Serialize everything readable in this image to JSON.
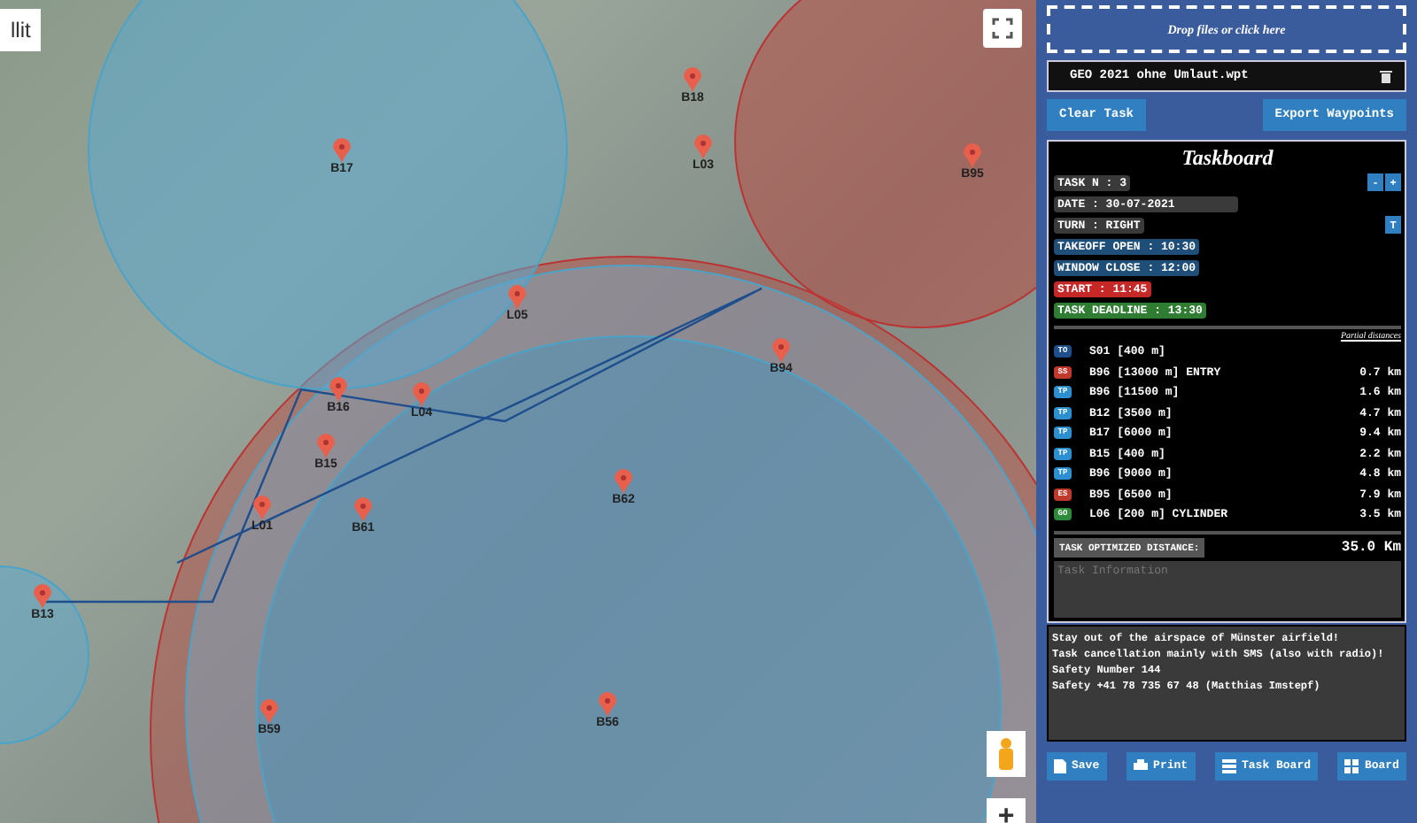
{
  "map": {
    "layer_button": "llit",
    "waypoints": [
      {
        "label": "B17"
      },
      {
        "label": "B18"
      },
      {
        "label": "L03"
      },
      {
        "label": "B95"
      },
      {
        "label": "L05"
      },
      {
        "label": "B16"
      },
      {
        "label": "L04"
      },
      {
        "label": "B94"
      },
      {
        "label": "B15"
      },
      {
        "label": "L01"
      },
      {
        "label": "B61"
      },
      {
        "label": "B62"
      },
      {
        "label": "B13"
      },
      {
        "label": "B59"
      },
      {
        "label": "B56"
      }
    ],
    "zoom_in": "+"
  },
  "panel": {
    "drop_zone": "Drop files or click here",
    "file": {
      "name": "GEO 2021 ohne Umlaut.wpt"
    },
    "actions": [
      "Clear Task",
      "Export Waypoints"
    ],
    "taskboard": {
      "title": "Taskboard",
      "fields": [
        {
          "text": "TASK N : 3",
          "color": "#3a3a3a"
        },
        {
          "text": "DATE : 30-07-2021",
          "color": "#3a3a3a"
        },
        {
          "text": "TURN : RIGHT",
          "color": "#3a3a3a"
        },
        {
          "text": "TAKEOFF OPEN : 10:30",
          "color": "#1f4e79"
        },
        {
          "text": "WINDOW CLOSE : 12:00",
          "color": "#1f4e79"
        },
        {
          "text": "START : 11:45",
          "color": "#c62828"
        },
        {
          "text": "TASK DEADLINE : 13:30",
          "color": "#2e7d32"
        }
      ],
      "minus": "-",
      "plus": "+",
      "turn_toggle": "T",
      "partial_header": "Partial distances",
      "turnpoints": [
        {
          "type": "TO",
          "color": "#1f4e8c",
          "name": "S01 [400 m]"
        },
        {
          "type": "SS",
          "color": "#c0392b",
          "name": "B96 [13000 m] ENTRY",
          "distance": "0.7 km"
        },
        {
          "type": "TP",
          "color": "#2b8fd0",
          "name": "B96 [11500 m]",
          "distance": "1.6 km"
        },
        {
          "type": "TP",
          "color": "#2b8fd0",
          "name": "B12 [3500 m]",
          "distance": "4.7 km"
        },
        {
          "type": "TP",
          "color": "#2b8fd0",
          "name": "B17 [6000 m]",
          "distance": "9.4 km"
        },
        {
          "type": "TP",
          "color": "#2b8fd0",
          "name": "B15 [400 m]",
          "distance": "2.2 km"
        },
        {
          "type": "TP",
          "color": "#2b8fd0",
          "name": "B96 [9000 m]",
          "distance": "4.8 km"
        },
        {
          "type": "ES",
          "color": "#c0392b",
          "name": "B95 [6500 m]",
          "distance": "7.9 km"
        },
        {
          "type": "GO",
          "color": "#2e8b3c",
          "name": "L06 [200 m] CYLINDER",
          "distance": "3.5 km"
        }
      ],
      "optimized_label": "TASK OPTIMIZED DISTANCE:",
      "optimized_value": "35.0 Km",
      "info_placeholder": "Task Information",
      "notes": [
        "Stay out of the airspace of Münster airfield!",
        "Task cancellation mainly with SMS (also with radio)!",
        "Safety Number 144",
        "Safety +41 78 735 67 48 (Matthias Imstepf)"
      ]
    },
    "bottom_buttons": [
      {
        "kind": "save",
        "label": "Save"
      },
      {
        "kind": "print",
        "label": "Print"
      },
      {
        "kind": "list",
        "label": "Task Board"
      },
      {
        "kind": "grid",
        "label": "Board"
      }
    ]
  }
}
